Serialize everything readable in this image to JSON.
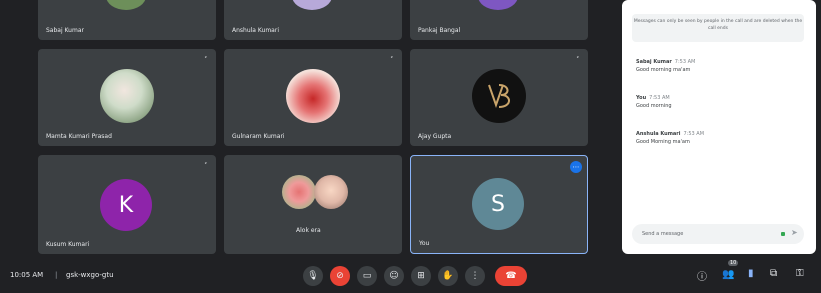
{
  "participants": [
    {
      "name": "Sabaj Kumar"
    },
    {
      "name": "Anshula Kumari"
    },
    {
      "name": "Pankaj Bangal"
    },
    {
      "name": "Mamta Kumari Prasad"
    },
    {
      "name": "Gulnaram Kumari"
    },
    {
      "name": "Ajay Gupta"
    },
    {
      "name": "Kusum Kumari",
      "initial": "K"
    },
    {
      "name": "Alok era"
    },
    {
      "name": "You",
      "initial": "S"
    }
  ],
  "colors": {
    "tile": "#3c4043",
    "avatar_k": "#8e24aa",
    "avatar_s": "#5f8896",
    "end_call": "#ea4335",
    "chat_accent": "#1a73e8"
  },
  "chat": {
    "notice": "Messages can only be seen by people in the call and are deleted when the call ends",
    "messages": [
      {
        "sender": "Sabaj Kumar",
        "time": "7:53 AM",
        "text": "Good morning ma'am"
      },
      {
        "sender": "You",
        "time": "7:53 AM",
        "text": "Good morning"
      },
      {
        "sender": "Anshula Kumari",
        "time": "7:53 AM",
        "text": "Good Morning ma'am"
      }
    ],
    "input_placeholder": "Send a message"
  },
  "meeting": {
    "time": "10:05 AM",
    "code": "gsk-wxgo-gtu",
    "participant_count": "10"
  }
}
